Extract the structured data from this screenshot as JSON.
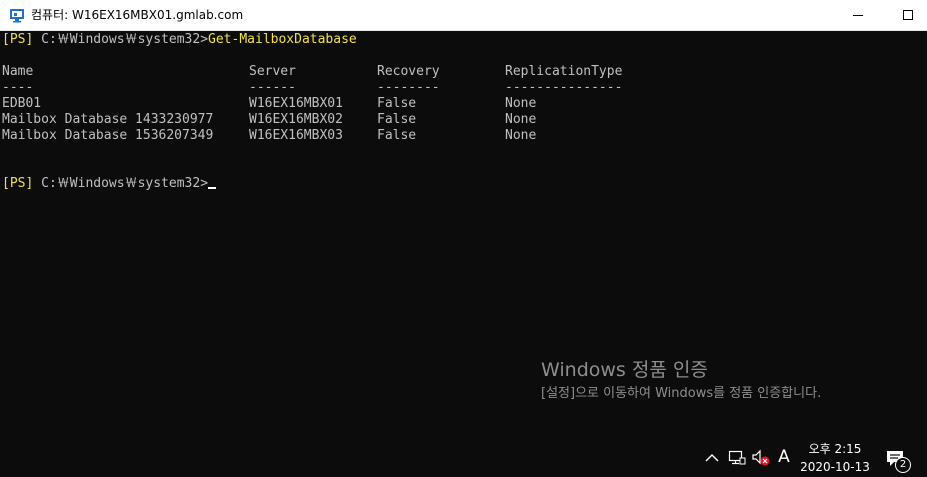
{
  "window": {
    "title": "컴퓨터: W16EX16MBX01.gmlab.com",
    "icon": "remote-desktop-icon"
  },
  "console": {
    "prompt1": {
      "tag": "[PS]",
      "path": " C:￦Windows￦system32>",
      "command": "Get-MailboxDatabase"
    },
    "headers": [
      "Name",
      "Server",
      "Recovery",
      "ReplicationType"
    ],
    "underlines": [
      "----",
      "------",
      "--------",
      "---------------"
    ],
    "rows": [
      [
        "EDB01",
        "W16EX16MBX01",
        "False",
        "None"
      ],
      [
        "Mailbox Database 1433230977",
        "W16EX16MBX02",
        "False",
        "None"
      ],
      [
        "Mailbox Database 1536207349",
        "W16EX16MBX03",
        "False",
        "None"
      ]
    ],
    "prompt2": {
      "tag": "[PS]",
      "path": " C:￦Windows￦system32>"
    }
  },
  "activation": {
    "title": "Windows 정품 인증",
    "subtitle": "[설정]으로 이동하여 Windows를 정품 인증합니다."
  },
  "tray": {
    "ime_label": "A",
    "time": "오후 2:15",
    "date": "2020-10-13",
    "notification_count": "2",
    "icons": [
      "chevron-up-icon",
      "network-icon",
      "volume-muted-icon",
      "notification-icon"
    ]
  }
}
